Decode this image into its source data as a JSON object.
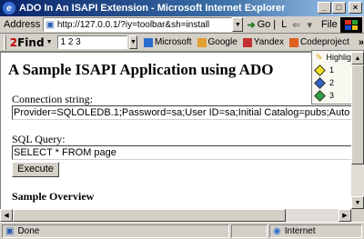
{
  "window": {
    "title": "ADO In An ISAPI Extension - Microsoft Internet Explorer"
  },
  "address": {
    "label": "Address",
    "url": "http://127.0.0.1/?iy=toolbar&sh=install",
    "go": "Go",
    "links": "L",
    "separator": "|"
  },
  "menu": {
    "file": "File",
    "chevron": "»"
  },
  "toolbar": {
    "brand_two": "2",
    "brand_find": "Find",
    "search_value": "1 2 3",
    "items": [
      {
        "label": "Microsoft",
        "color": "#2a6fd0"
      },
      {
        "label": "Google",
        "color": "#e0a030"
      },
      {
        "label": "Yandex",
        "color": "#c03030"
      },
      {
        "label": "Codeproject",
        "color": "#e06020"
      }
    ],
    "chevron": "»"
  },
  "highlight_panel": {
    "title": "Highlight",
    "items": [
      {
        "label": "1",
        "color": "#f0e020"
      },
      {
        "label": "2",
        "color": "#3060c0"
      },
      {
        "label": "3",
        "color": "#30a040"
      }
    ]
  },
  "page": {
    "heading": "A Sample ISAPI Application using ADO",
    "connection_label": "Connection string:",
    "connection_value": "Provider=SQLOLEDB.1;Password=sa;User ID=sa;Initial Catalog=pubs;Auto Translate=",
    "query_label": "SQL Query:",
    "query_value": "SELECT * FROM page",
    "execute_label": "Execute",
    "overview_heading": "Sample Overview"
  },
  "status": {
    "text": "Done",
    "zone": "Internet"
  }
}
